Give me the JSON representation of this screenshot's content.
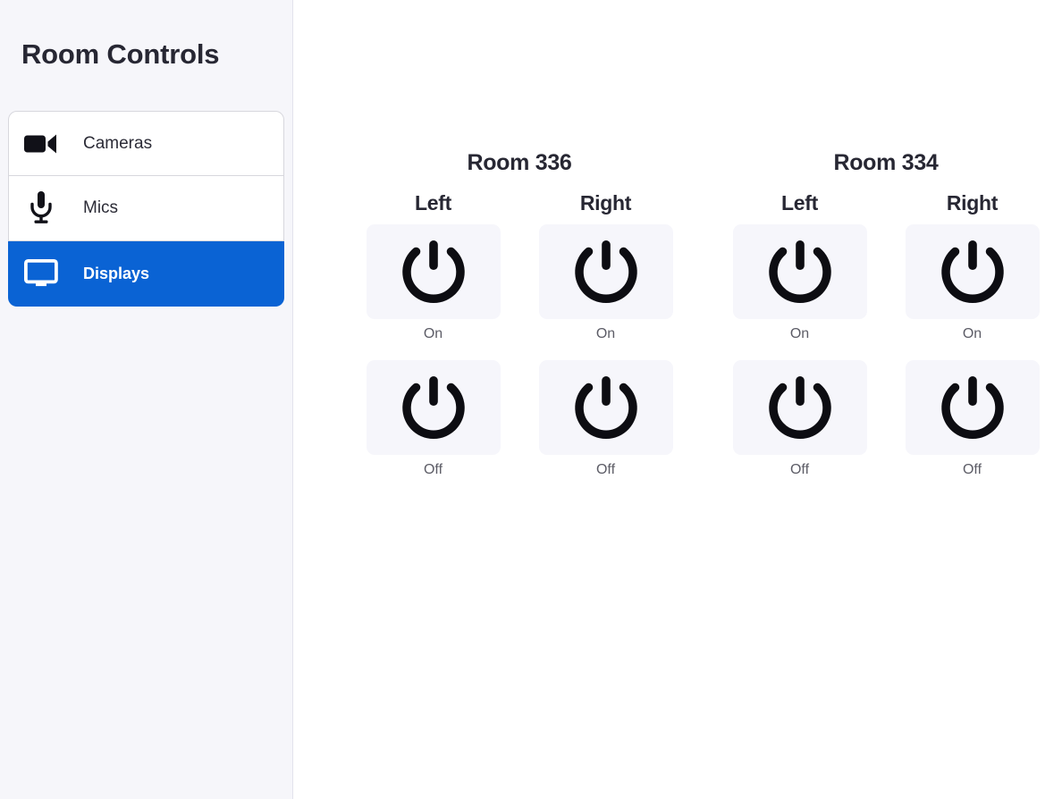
{
  "sidebar": {
    "title": "Room Controls",
    "items": [
      {
        "label": "Cameras",
        "icon": "video-camera-icon",
        "active": false
      },
      {
        "label": "Mics",
        "icon": "microphone-icon",
        "active": false
      },
      {
        "label": "Displays",
        "icon": "monitor-icon",
        "active": true
      }
    ]
  },
  "colors": {
    "accent": "#0a63d4",
    "sidebar_bg": "#f6f6fa",
    "tile_bg": "#f6f6fb",
    "text_dark": "#272733",
    "text_muted": "#5c5c66"
  },
  "main": {
    "rooms": [
      {
        "title": "Room 336",
        "sides": [
          {
            "title": "Left",
            "buttons": [
              {
                "icon": "power-icon",
                "label": "On"
              },
              {
                "icon": "power-icon",
                "label": "Off"
              }
            ]
          },
          {
            "title": "Right",
            "buttons": [
              {
                "icon": "power-icon",
                "label": "On"
              },
              {
                "icon": "power-icon",
                "label": "Off"
              }
            ]
          }
        ]
      },
      {
        "title": "Room 334",
        "sides": [
          {
            "title": "Left",
            "buttons": [
              {
                "icon": "power-icon",
                "label": "On"
              },
              {
                "icon": "power-icon",
                "label": "Off"
              }
            ]
          },
          {
            "title": "Right",
            "buttons": [
              {
                "icon": "power-icon",
                "label": "On"
              },
              {
                "icon": "power-icon",
                "label": "Off"
              }
            ]
          }
        ]
      }
    ]
  }
}
